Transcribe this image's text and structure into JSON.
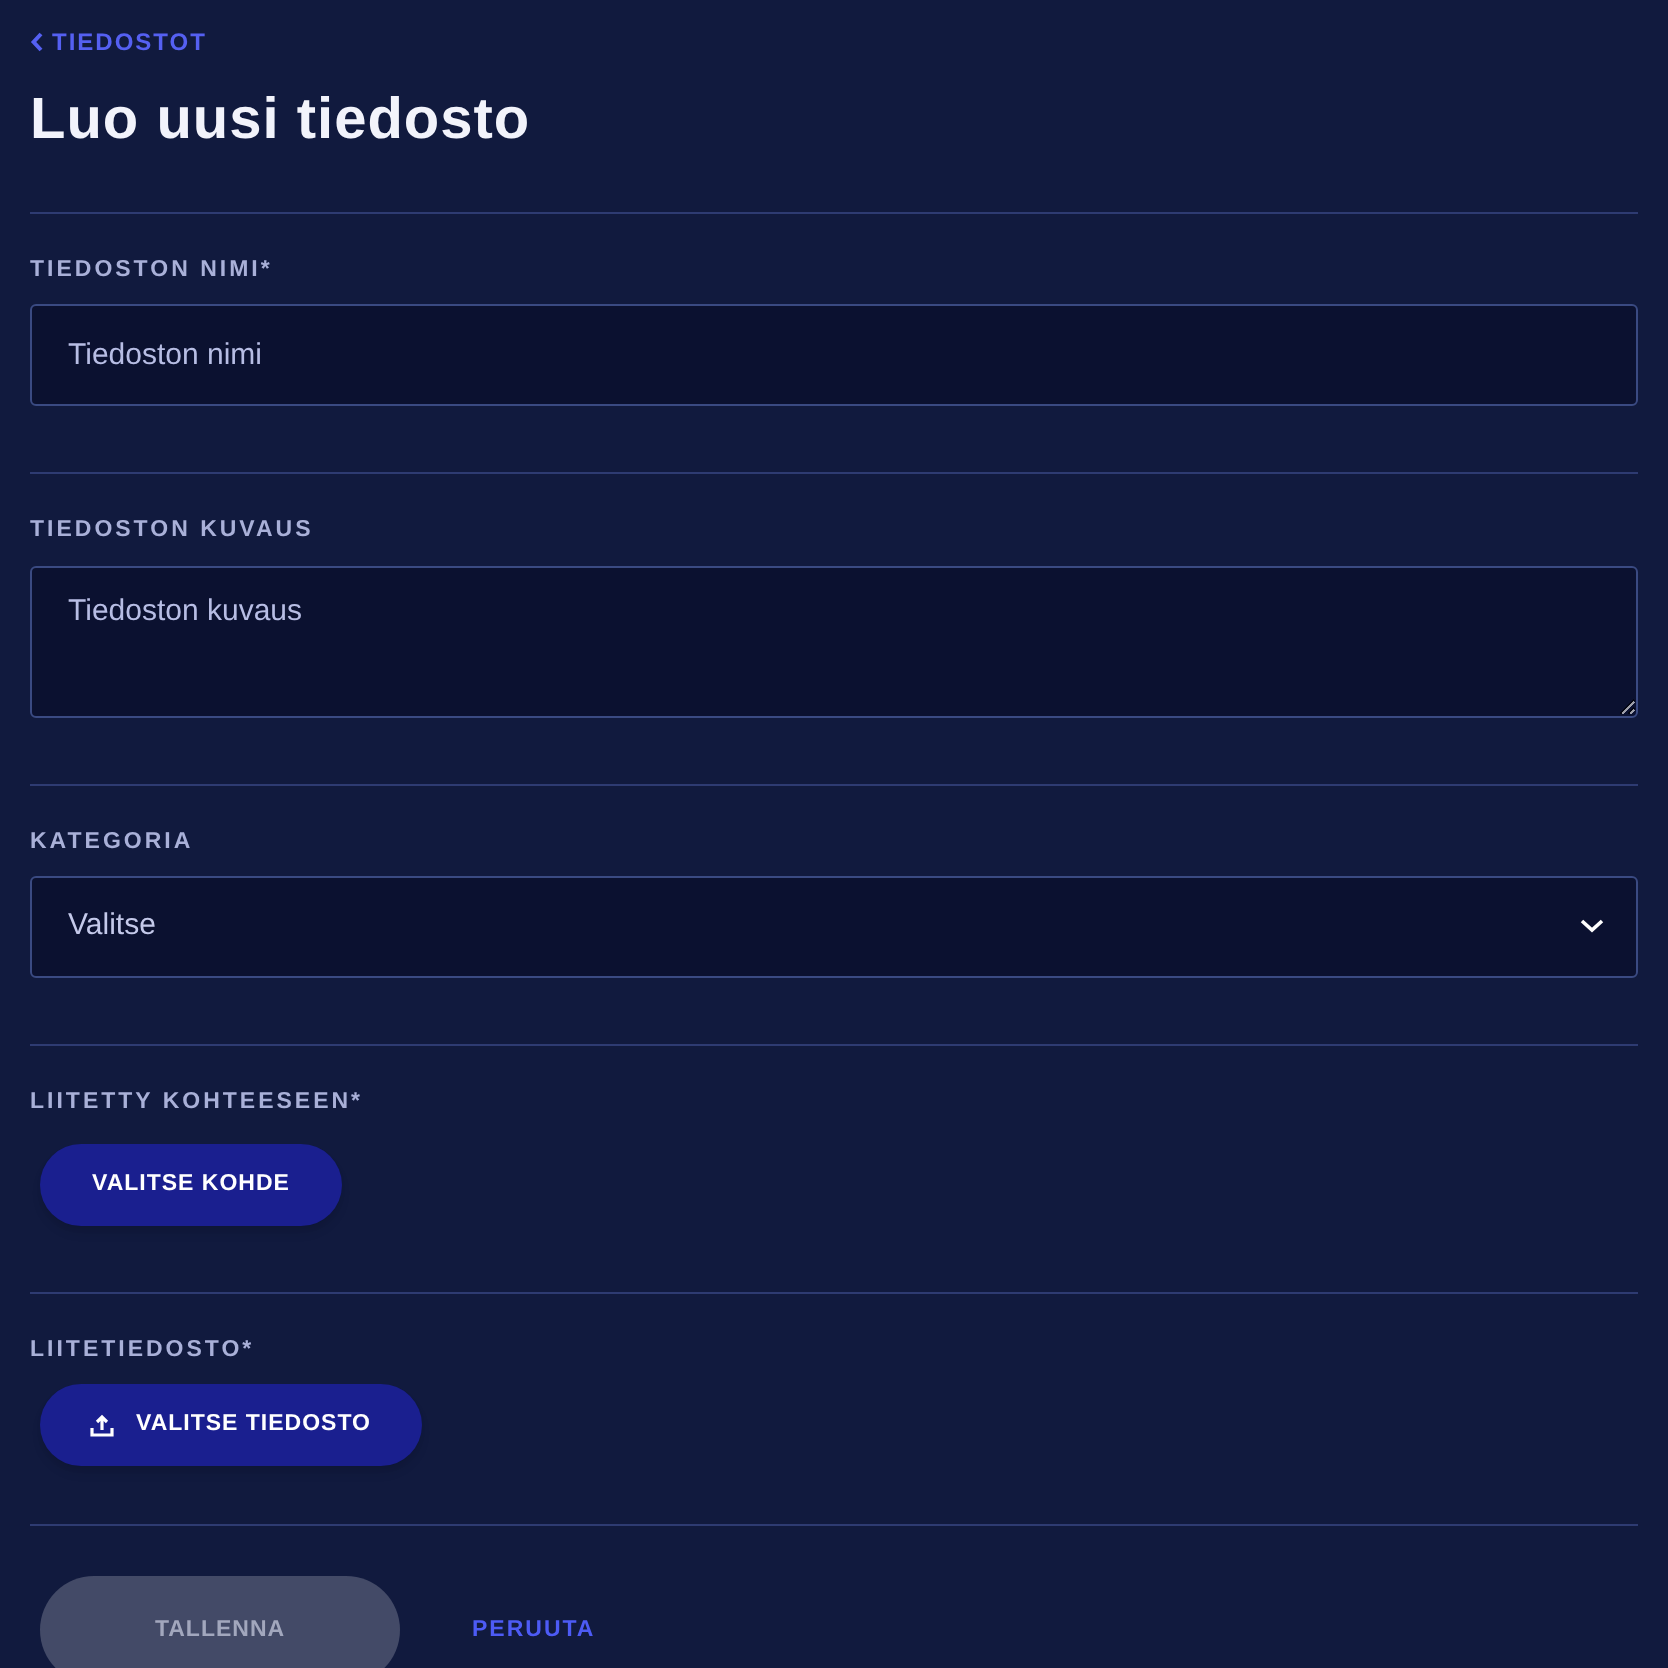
{
  "back_link": "TIEDOSTOT",
  "title": "Luo uusi tiedosto",
  "fields": [
    {
      "kind": "text",
      "label": "TIEDOSTON NIMI*",
      "placeholder": "Tiedoston nimi"
    },
    {
      "kind": "textarea",
      "label": "TIEDOSTON KUVAUS",
      "placeholder": "Tiedoston kuvaus"
    },
    {
      "kind": "select",
      "label": "KATEGORIA",
      "value": "Valitse"
    },
    {
      "kind": "button",
      "label": "LIITETTY KOHTEESEEN*",
      "button": "VALITSE KOHDE"
    },
    {
      "kind": "upload",
      "label": "LIITETIEDOSTO*",
      "button": "VALITSE TIEDOSTO"
    }
  ],
  "actions": {
    "save": {
      "label": "TALLENNA",
      "disabled": true
    },
    "cancel": "PERUUTA"
  }
}
